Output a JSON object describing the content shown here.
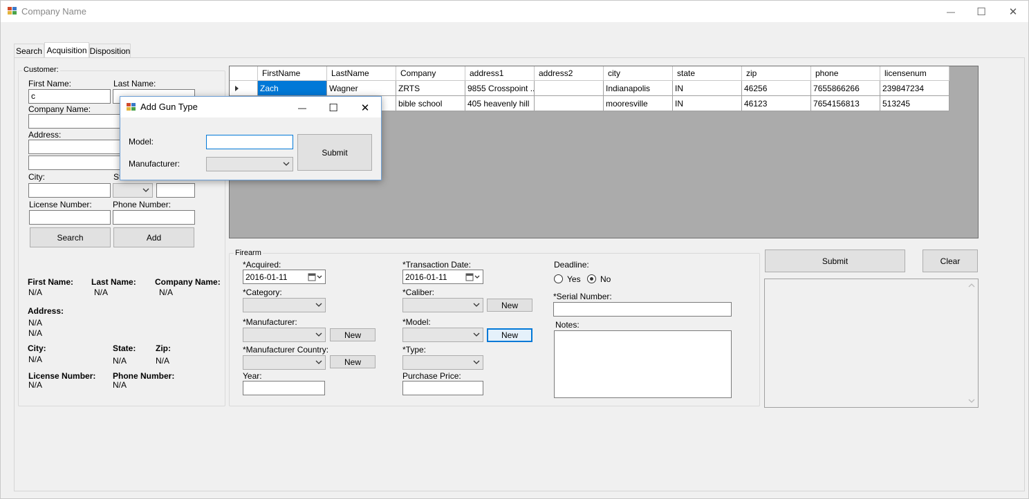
{
  "window": {
    "title": "Company Name",
    "controls": {
      "minimize": "—",
      "maximize": "☐",
      "close": "✕"
    }
  },
  "tabs": [
    "Search",
    "Acquisition",
    "Disposition"
  ],
  "customer": {
    "group_title": "Customer:",
    "first_name_label": "First Name:",
    "first_name_value": "c",
    "last_name_label": "Last Name:",
    "company_label": "Company Name:",
    "address_label": "Address:",
    "city_label": "City:",
    "state_label_partial": "St",
    "license_label": "License Number:",
    "phone_label": "Phone Number:",
    "search_button": "Search",
    "add_button": "Add"
  },
  "summary": {
    "first_name_label": "First Name:",
    "first_name_value": "N/A",
    "last_name_label": "Last Name:",
    "last_name_value": "N/A",
    "company_label": "Company Name:",
    "company_value": "N/A",
    "address_label": "Address:",
    "address_line1": "N/A",
    "address_line2": "N/A",
    "city_label": "City:",
    "city_value": "N/A",
    "state_label": "State:",
    "state_value": "N/A",
    "zip_label": "Zip:",
    "zip_value": "N/A",
    "license_label": "License Number:",
    "license_value": "N/A",
    "phone_label": "Phone Number:",
    "phone_value": "N/A"
  },
  "grid": {
    "columns": [
      "FirstName",
      "LastName",
      "Company",
      "address1",
      "address2",
      "city",
      "state",
      "zip",
      "phone",
      "licensenum"
    ],
    "rows": [
      [
        "Zach",
        "Wagner",
        "ZRTS",
        "9855 Crosspoint ...",
        "",
        "Indianapolis",
        "IN",
        "46256",
        "7655866266",
        "239847234"
      ],
      [
        "",
        "",
        "bible school",
        "405 heavenly hill",
        "",
        "mooresville",
        "IN",
        "46123",
        "7654156813",
        "513245"
      ]
    ]
  },
  "firearm": {
    "group_title": "Firearm",
    "acquired_label": "*Acquired:",
    "acquired_value": "2016-01-11",
    "transaction_label": "*Transaction Date:",
    "transaction_value": "2016-01-11",
    "deadline_label": "Deadline:",
    "deadline_yes": "Yes",
    "deadline_no": "No",
    "deadline_selected": "No",
    "category_label": "*Category:",
    "caliber_label": "*Caliber:",
    "serial_label": "*Serial Number:",
    "manufacturer_label": "*Manufacturer:",
    "model_label": "*Model:",
    "notes_label": "Notes:",
    "manufacturer_country_label": "*Manufacturer Country:",
    "type_label": "*Type:",
    "year_label": "Year:",
    "price_label": "Purchase Price:",
    "new_button": "New"
  },
  "actions": {
    "submit": "Submit",
    "clear": "Clear"
  },
  "dialog": {
    "title": "Add Gun Type",
    "model_label": "Model:",
    "manufacturer_label": "Manufacturer:",
    "submit_button": "Submit"
  }
}
